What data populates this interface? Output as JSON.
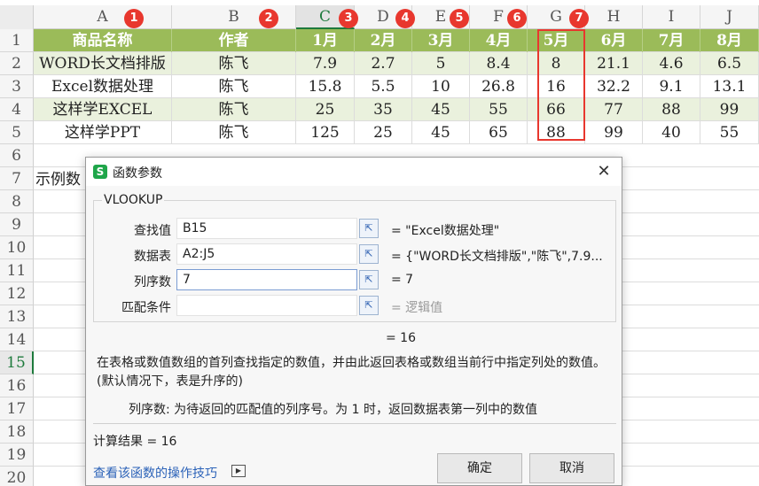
{
  "columns": [
    "A",
    "B",
    "C",
    "D",
    "E",
    "F",
    "G",
    "H",
    "I",
    "J"
  ],
  "rows": [
    "1",
    "2",
    "3",
    "4",
    "5",
    "6",
    "7",
    "8",
    "9",
    "10",
    "11",
    "12",
    "13",
    "14",
    "15",
    "16",
    "17",
    "18",
    "19",
    "20"
  ],
  "active_column": "C",
  "active_row": "15",
  "badges": [
    "1",
    "2",
    "3",
    "4",
    "5",
    "6",
    "7"
  ],
  "table": {
    "header": [
      "商品名称",
      "作者",
      "1月",
      "2月",
      "3月",
      "4月",
      "5月",
      "6月",
      "7月",
      "8月"
    ],
    "data": [
      [
        "WORD长文档排版",
        "陈飞",
        "7.9",
        "2.7",
        "5",
        "8.4",
        "8",
        "21.1",
        "4.6",
        "6.5"
      ],
      [
        "Excel数据处理",
        "陈飞",
        "15.8",
        "5.5",
        "10",
        "26.8",
        "16",
        "32.2",
        "9.1",
        "13.1"
      ],
      [
        "这样学EXCEL",
        "陈飞",
        "25",
        "35",
        "45",
        "55",
        "66",
        "77",
        "88",
        "99"
      ],
      [
        "这样学PPT",
        "陈飞",
        "125",
        "25",
        "45",
        "65",
        "88",
        "99",
        "40",
        "55"
      ]
    ]
  },
  "a7_text": "示例数",
  "dialog": {
    "title": "函数参数",
    "app_icon": "S",
    "close": "✕",
    "function_name": "VLOOKUP",
    "args": [
      {
        "label": "查找值",
        "value": "B15",
        "result": "= \"Excel数据处理\""
      },
      {
        "label": "数据表",
        "value": "A2:J5",
        "result": "= {\"WORD长文档排版\",\"陈飞\",7.9..."
      },
      {
        "label": "列序数",
        "value": "7",
        "result": "= 7"
      },
      {
        "label": "匹配条件",
        "value": "",
        "result": "= 逻辑值"
      }
    ],
    "ref_button_icon": "⇱",
    "overall_result": "= 16",
    "description": "在表格或数值数组的首列查找指定的数值，并由此返回表格或数组当前行中指定列处的数值。 (默认情况下，表是升序的)",
    "arg_help": "列序数:  为待返回的匹配值的列序号。为 1 时，返回数据表第一列中的数值",
    "calc_result": "计算结果 = 16",
    "help_link": "查看该函数的操作技巧",
    "ok_label": "确定",
    "cancel_label": "取消"
  },
  "colors": {
    "header_green": "#9bbb59",
    "band_green": "#eaf1dd",
    "badge_red": "#e8372e",
    "active_green": "#1e7a3c"
  }
}
